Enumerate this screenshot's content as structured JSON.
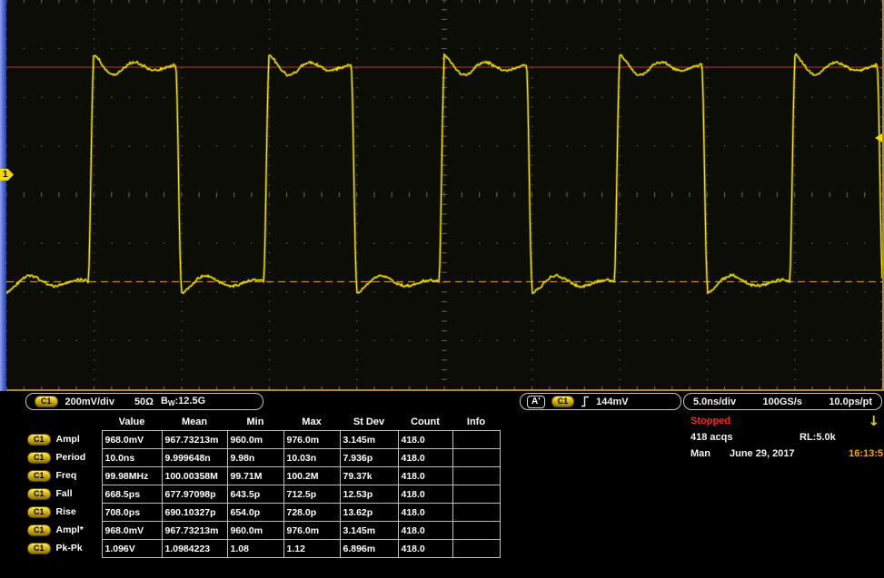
{
  "scope": {
    "channel_marker": "1",
    "waveform": {
      "type": "square",
      "cycles_visible": 5,
      "trace_color": "#f3e300",
      "top_ref_color": "#a33000",
      "base_ref_color": "#cc8a1e",
      "grid_color": "#4e4e40"
    }
  },
  "footer": {
    "channel": {
      "badge": "C1",
      "scale": "200mV/div",
      "impedance": "50Ω",
      "bandwidth_prefix": "B",
      "bandwidth_sub": "W",
      "bandwidth_value": ":12.5G"
    },
    "trigger": {
      "label": "A'",
      "badge": "C1",
      "level": "144mV"
    },
    "timebase": {
      "scale": "5.0ns/div",
      "rate": "100GS/s",
      "resolution": "10.0ps/pt"
    },
    "status": {
      "state": "Stopped",
      "acquisitions": "418 acqs",
      "record_length": "RL:5.0k",
      "mode": "Man",
      "date": "June 29, 2017",
      "time": "16:13:5",
      "down_arrow": "↓"
    }
  },
  "table": {
    "headers": [
      "Value",
      "Mean",
      "Min",
      "Max",
      "St Dev",
      "Count",
      "Info"
    ],
    "rows": [
      {
        "badge": "C1",
        "label": "Ampl",
        "values": [
          "968.0mV",
          "967.73213m",
          "960.0m",
          "976.0m",
          "3.145m",
          "418.0",
          ""
        ]
      },
      {
        "badge": "C1",
        "label": "Period",
        "values": [
          "10.0ns",
          "9.999648n",
          "9.98n",
          "10.03n",
          "7.936p",
          "418.0",
          ""
        ]
      },
      {
        "badge": "C1",
        "label": "Freq",
        "values": [
          "99.98MHz",
          "100.00358M",
          "99.71M",
          "100.2M",
          "79.37k",
          "418.0",
          ""
        ]
      },
      {
        "badge": "C1",
        "label": "Fall",
        "values": [
          "668.5ps",
          "677.97098p",
          "643.5p",
          "712.5p",
          "12.53p",
          "418.0",
          ""
        ]
      },
      {
        "badge": "C1",
        "label": "Rise",
        "values": [
          "708.0ps",
          "690.10327p",
          "654.0p",
          "728.0p",
          "13.62p",
          "418.0",
          ""
        ]
      },
      {
        "badge": "C1",
        "label": "Ampl*",
        "values": [
          "968.0mV",
          "967.73213m",
          "960.0m",
          "976.0m",
          "3.145m",
          "418.0",
          ""
        ]
      },
      {
        "badge": "C1",
        "label": "Pk-Pk",
        "values": [
          "1.096V",
          "1.0984223",
          "1.08",
          "1.12",
          "6.896m",
          "418.0",
          ""
        ]
      }
    ]
  }
}
